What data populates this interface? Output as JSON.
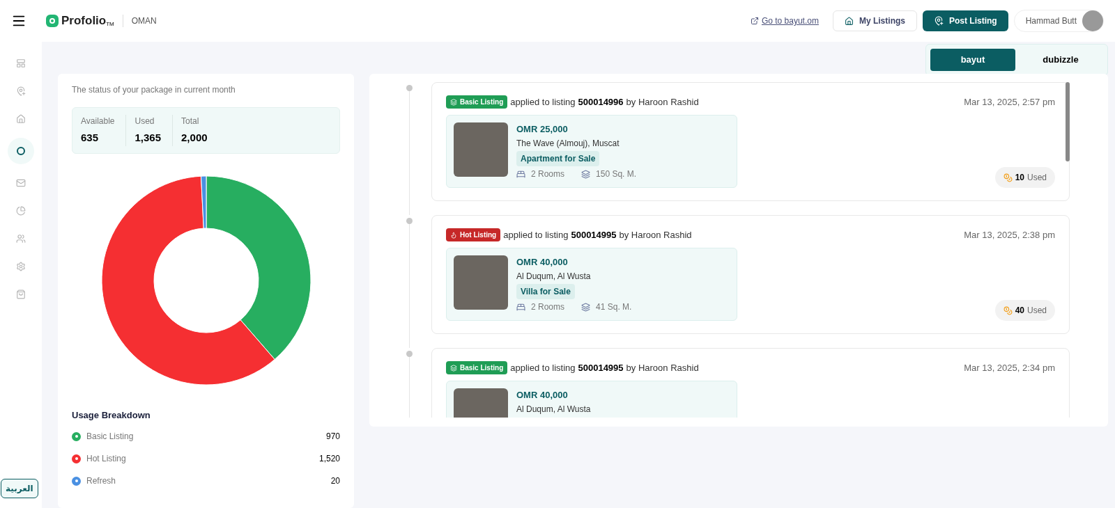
{
  "header": {
    "brand": "Profolio",
    "trademark": "TM",
    "country": "OMAN",
    "external_link": "Go to bayut.om",
    "my_listings": "My Listings",
    "post_listing": "Post Listing",
    "user_name": "Hammad Butt"
  },
  "sidebar": {
    "items": [
      {
        "kind": "layout",
        "selected": false
      },
      {
        "kind": "pin",
        "selected": false
      },
      {
        "kind": "house",
        "selected": false
      },
      {
        "kind": "credits",
        "selected": true
      },
      {
        "kind": "mail",
        "selected": false
      },
      {
        "kind": "pie",
        "selected": false
      },
      {
        "kind": "users",
        "selected": false
      },
      {
        "kind": "gear",
        "selected": false
      },
      {
        "kind": "bag",
        "selected": false
      }
    ],
    "language": "العربية"
  },
  "platforms": [
    {
      "label": "bayut",
      "selected": true
    },
    {
      "label": "dubizzle",
      "selected": false
    }
  ],
  "package": {
    "subtitle": "The status of your package in current month",
    "stats": [
      {
        "label": "Available",
        "value": "635"
      },
      {
        "label": "Used",
        "value": "1,365"
      },
      {
        "label": "Total",
        "value": "2,000"
      }
    ],
    "breakdown_title": "Usage Breakdown",
    "breakdown": [
      {
        "label": "Basic Listing",
        "value": "970",
        "color": "#27ae60"
      },
      {
        "label": "Hot Listing",
        "value": "1,520",
        "color": "#f52f32"
      },
      {
        "label": "Refresh",
        "value": "20",
        "color": "#4a90e2"
      }
    ]
  },
  "activity": [
    {
      "kind": "basic",
      "badge": "Basic Listing",
      "text": "applied to listing",
      "listing_id": "500014996",
      "by": "by Haroon Rashid",
      "date": "Mar 13, 2025, 2:57 pm",
      "price": "OMR 25,000",
      "location": "The Wave (Almouj), Muscat",
      "type": "Apartment for Sale",
      "rooms": "2 Rooms",
      "area": "150 Sq. M.",
      "used_count": "10",
      "used_label": "Used"
    },
    {
      "kind": "hot",
      "badge": "Hot Listing",
      "text": "applied to listing",
      "listing_id": "500014995",
      "by": "by Haroon Rashid",
      "date": "Mar 13, 2025, 2:38 pm",
      "price": "OMR 40,000",
      "location": "Al Duqum, Al Wusta",
      "type": "Villa for Sale",
      "rooms": "2 Rooms",
      "area": "41 Sq. M.",
      "used_count": "40",
      "used_label": "Used"
    },
    {
      "kind": "basic",
      "badge": "Basic Listing",
      "text": "applied to listing",
      "listing_id": "500014995",
      "by": "by Haroon Rashid",
      "date": "Mar 13, 2025, 2:34 pm",
      "price": "OMR 40,000",
      "location": "Al Duqum, Al Wusta"
    }
  ]
}
